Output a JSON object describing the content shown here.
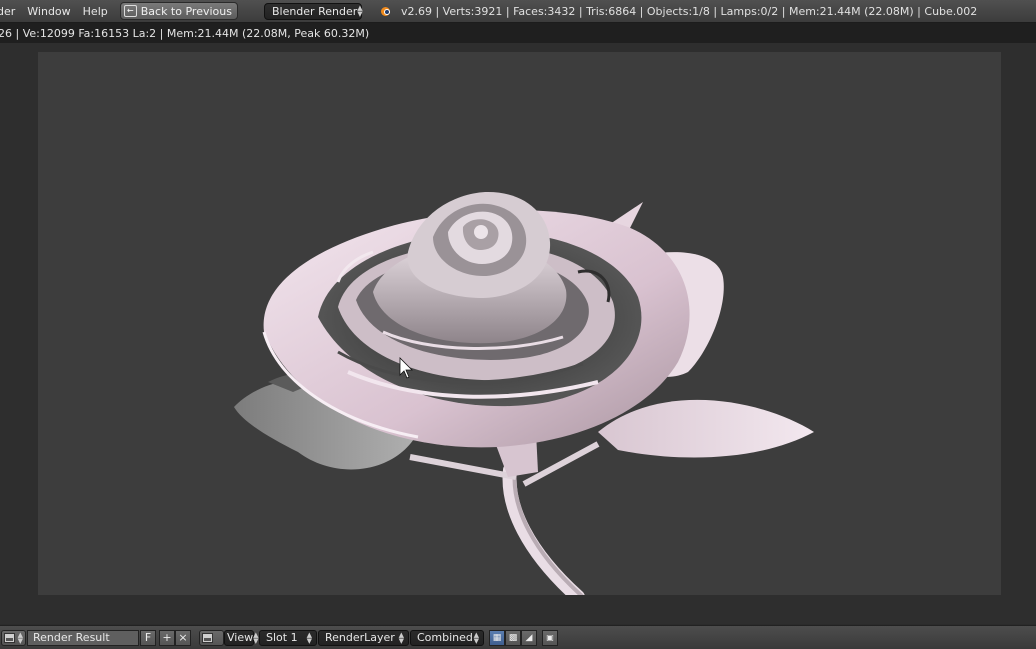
{
  "topbar": {
    "menus": [
      "der",
      "Window",
      "Help"
    ],
    "back_button": "Back to Previous",
    "render_engine": "Blender Render",
    "stats": "v2.69 | Verts:3921 | Faces:3432 | Tris:6864 | Objects:1/8 | Lamps:0/2 | Mem:21.44M (22.08M) | Cube.002"
  },
  "infobar": {
    "text": "26 | Ve:12099 Fa:16153 La:2 | Mem:21.44M (22.08M, Peak 60.32M)"
  },
  "bottombar": {
    "image_name": "Render Result",
    "fake_user": "F",
    "view_menu": "View",
    "slot": "Slot 1",
    "render_layer": "RenderLayer",
    "pass": "Combined"
  },
  "icons": [
    "image-editor-icon",
    "new-image-icon",
    "unlink-icon",
    "blender-logo-icon",
    "back-icon",
    "draw-alpha-icon",
    "checker-icon",
    "z-buffer-icon",
    "pin-icon",
    "cursor-icon"
  ],
  "colors": {
    "render_background": "#3d3d3d",
    "petal_pink": "#e9d4e0",
    "leaf_grey": "#8a8a8a"
  }
}
